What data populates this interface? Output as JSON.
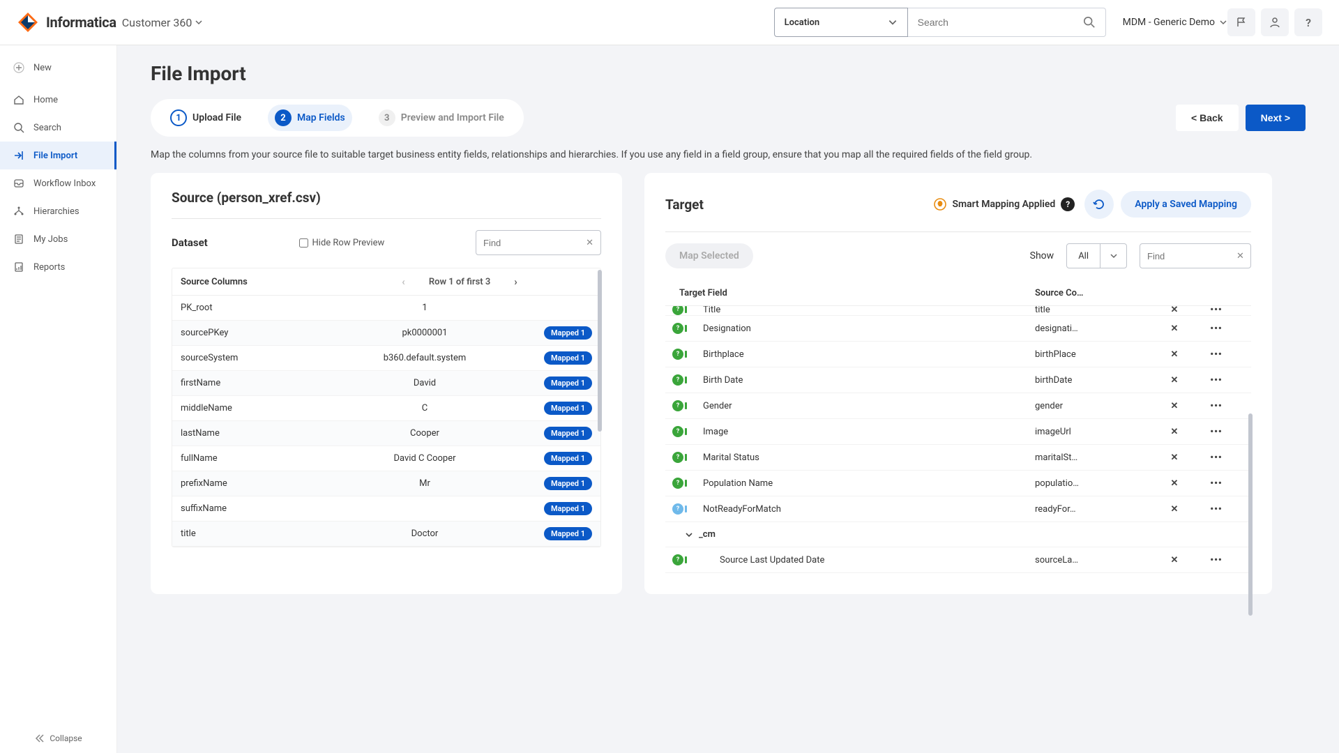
{
  "brand": "Informatica",
  "subproduct": "Customer 360",
  "location_label": "Location",
  "search_placeholder": "Search",
  "tenant": "MDM - Generic Demo",
  "sidebar": {
    "new": "New",
    "home": "Home",
    "search": "Search",
    "file_import": "File Import",
    "workflow_inbox": "Workflow Inbox",
    "hierarchies": "Hierarchies",
    "my_jobs": "My Jobs",
    "reports": "Reports",
    "collapse": "Collapse"
  },
  "page_title": "File Import",
  "steps": {
    "upload": "Upload File",
    "map": "Map Fields",
    "preview": "Preview and Import File"
  },
  "back_btn": "< Back",
  "next_btn": "Next >",
  "description": "Map the columns from your source file to suitable target business entity fields, relationships and hierarchies. If you use any field in a field group, ensure that you map all the required fields of the field group.",
  "source": {
    "title": "Source (person_xref.csv)",
    "dataset": "Dataset",
    "hide_row_preview": "Hide Row Preview",
    "find_placeholder": "Find",
    "col_source_columns": "Source Columns",
    "row_indicator": "Row 1 of first 3",
    "mapped_badge": "Mapped 1",
    "rows": [
      {
        "name": "PK_root",
        "val": "1",
        "mapped": false
      },
      {
        "name": "sourcePKey",
        "val": "pk0000001",
        "mapped": true
      },
      {
        "name": "sourceSystem",
        "val": "b360.default.system",
        "mapped": true
      },
      {
        "name": "firstName",
        "val": "David",
        "mapped": true
      },
      {
        "name": "middleName",
        "val": "C",
        "mapped": true
      },
      {
        "name": "lastName",
        "val": "Cooper",
        "mapped": true
      },
      {
        "name": "fullName",
        "val": "David C Cooper",
        "mapped": true
      },
      {
        "name": "prefixName",
        "val": "Mr",
        "mapped": true
      },
      {
        "name": "suffixName",
        "val": "",
        "mapped": true
      },
      {
        "name": "title",
        "val": "Doctor",
        "mapped": true
      }
    ]
  },
  "target": {
    "title": "Target",
    "smart_applied": "Smart Mapping Applied",
    "apply_saved": "Apply a Saved Mapping",
    "map_selected": "Map Selected",
    "show": "Show",
    "show_value": "All",
    "find_placeholder": "Find",
    "col_target_field": "Target Field",
    "col_source_col": "Source Co…",
    "cm_group": "_cm",
    "rows": [
      {
        "field": "Title",
        "src": "title",
        "blue": false
      },
      {
        "field": "Designation",
        "src": "designati…",
        "blue": false
      },
      {
        "field": "Birthplace",
        "src": "birthPlace",
        "blue": false
      },
      {
        "field": "Birth Date",
        "src": "birthDate",
        "blue": false
      },
      {
        "field": "Gender",
        "src": "gender",
        "blue": false
      },
      {
        "field": "Image",
        "src": "imageUrl",
        "blue": false
      },
      {
        "field": "Marital Status",
        "src": "maritalSt…",
        "blue": false
      },
      {
        "field": "Population Name",
        "src": "populatio…",
        "blue": false
      },
      {
        "field": "NotReadyForMatch",
        "src": "readyFor…",
        "blue": true
      }
    ],
    "cm_rows": [
      {
        "field": "Source Last Updated Date",
        "src": "sourceLa…",
        "blue": false
      }
    ]
  }
}
